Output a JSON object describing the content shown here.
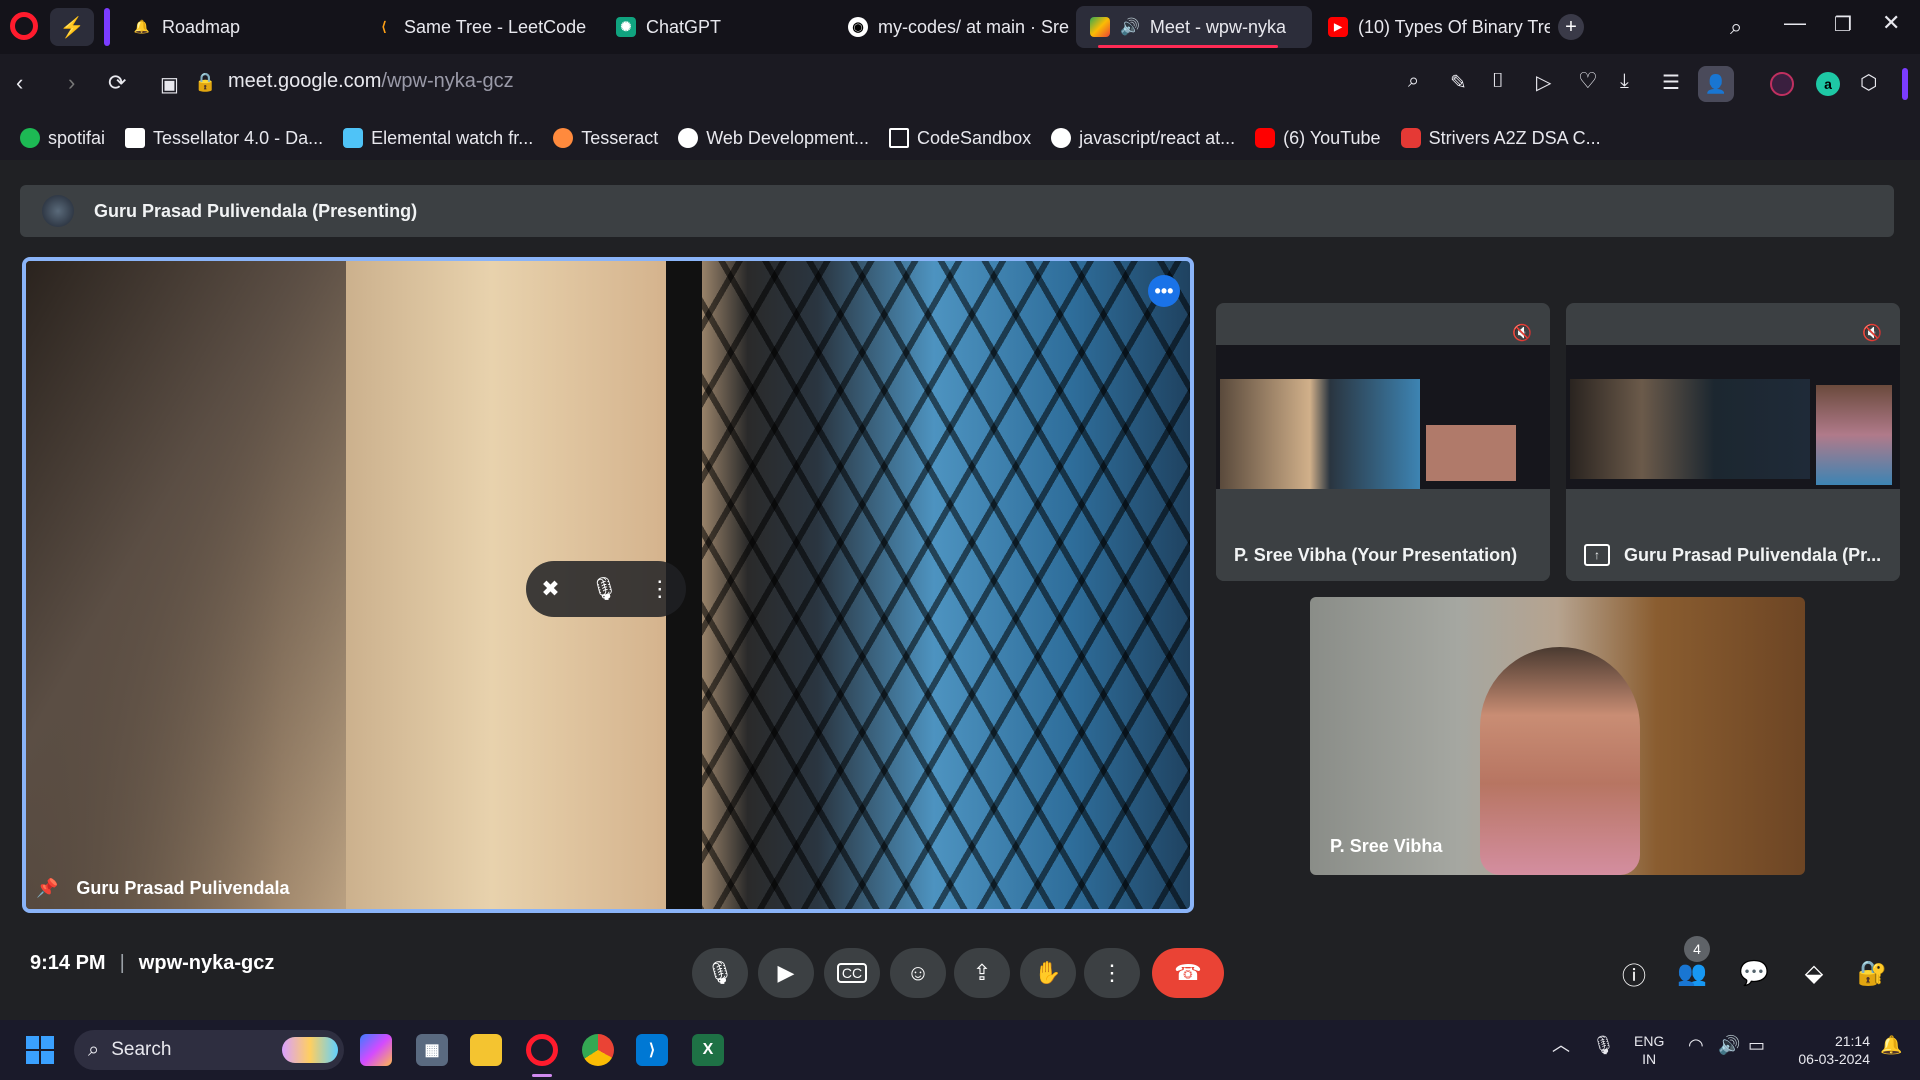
{
  "tabs": [
    {
      "label": "Roadmap",
      "icon": "bell-icon"
    },
    {
      "label": "Same Tree - LeetCode",
      "icon": "leetcode-icon"
    },
    {
      "label": "ChatGPT",
      "icon": "chatgpt-icon"
    },
    {
      "label": "my-codes/ at main · Sre",
      "icon": "github-icon"
    },
    {
      "label": "Meet - wpw-nyka",
      "icon": "meet-icon",
      "active": true
    },
    {
      "label": "(10) Types Of Binary Tre",
      "icon": "youtube-icon"
    }
  ],
  "address": {
    "url_prefix": "meet.google.com",
    "url_path": "/wpw-nyka-gcz"
  },
  "bookmarks": [
    {
      "label": "spotifai",
      "color": "#1db954"
    },
    {
      "label": "Tessellator 4.0 - Da...",
      "color": "#ffffff"
    },
    {
      "label": "Elemental watch fr...",
      "color": "#4fc3f7"
    },
    {
      "label": "Tesseract",
      "color": "#ff8a3d"
    },
    {
      "label": "Web Development...",
      "color": "#ffffff"
    },
    {
      "label": "CodeSandbox",
      "color": "#ffffff"
    },
    {
      "label": "javascript/react at...",
      "color": "#ffffff"
    },
    {
      "label": "(6) YouTube",
      "color": "#ff0000"
    },
    {
      "label": "Strivers A2Z DSA C...",
      "color": "#e53935"
    }
  ],
  "meet": {
    "presenting_label": "Guru Prasad Pulivendala (Presenting)",
    "main_name": "Guru Prasad Pulivendala",
    "thumb1_label": "P. Sree Vibha (Your Presentation)",
    "thumb2_label": "Guru Prasad Pulivendala (Pr...",
    "self_name": "P. Sree Vibha",
    "time": "9:14 PM",
    "code": "wpw-nyka-gcz",
    "participants_count": "4"
  },
  "taskbar": {
    "search_label": "Search",
    "lang_top": "ENG",
    "lang_bottom": "IN",
    "clock_time": "21:14",
    "clock_date": "06-03-2024"
  },
  "colors": {
    "accent": "#8ab4f8",
    "end_call": "#ea4335",
    "opera_red": "#ff1b2d"
  }
}
